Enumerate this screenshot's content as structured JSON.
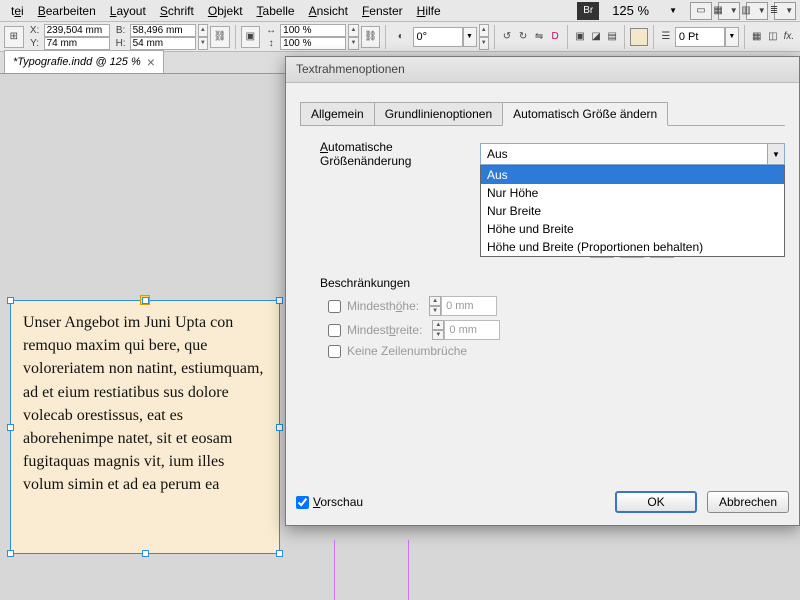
{
  "menu": {
    "items": [
      "tei",
      "Bearbeiten",
      "Layout",
      "Schrift",
      "Objekt",
      "Tabelle",
      "Ansicht",
      "Fenster",
      "Hilfe"
    ],
    "br": "Br",
    "zoom": "125 %"
  },
  "ctrl": {
    "x": "239,504 mm",
    "y": "74 mm",
    "b": "58,496 mm",
    "h": "54 mm",
    "scaleX": "100 %",
    "scaleY": "100 %",
    "rot": "0°",
    "stroke": "0 Pt"
  },
  "doc": {
    "tab": "*Typografie.indd @ 125 %"
  },
  "frametext": "Unser Angebot im Juni Upta con remquo maxim qui bere, que voloreriatem non natint, estiumquam, ad et eium resti­atibus sus dolore volecab ore­stissus, eat es aborehenimpe natet, sit et eosam fugitaquas magnis vit, ium illes volum simin et ad ea perum ea",
  "dialog": {
    "title": "Textrahmenoptionen",
    "tabs": [
      "Allgemein",
      "Grundlinienoptionen",
      "Automatisch Größe ändern"
    ],
    "active_tab": 2,
    "resize_label": "Automatische Größenänderung",
    "resize_value": "Aus",
    "resize_options": [
      "Aus",
      "Nur Höhe",
      "Nur Breite",
      "Höhe und Breite",
      "Höhe und Breite (Proportionen behalten)"
    ],
    "constraints_label": "Beschränkungen",
    "min_h": "Mindesthöhe:",
    "min_h_val": "0 mm",
    "min_b": "Mindestbreite:",
    "min_b_val": "0 mm",
    "nowrap": "Keine Zeilenumbrüche",
    "preview": "Vorschau",
    "ok": "OK",
    "cancel": "Abbrechen"
  }
}
